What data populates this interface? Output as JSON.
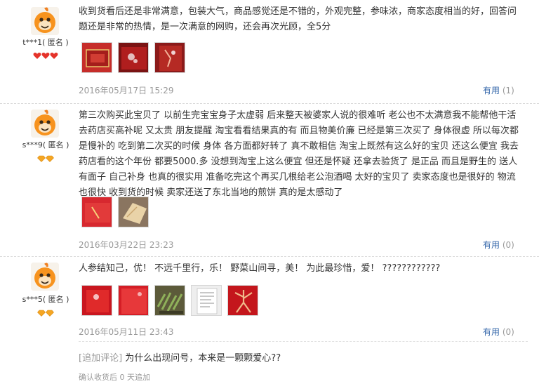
{
  "reviews": [
    {
      "user": "t***1",
      "anon": "( 匿名 )",
      "rank_icon": "red-heart",
      "rank_count": 3,
      "text": "收到货看后还是非常满意，包装大气，商品感觉还是不错的，外观完整，参味浓，商家态度相当的好，回答问题还是非常的热情，是一次满意的网购，还会再次光顾，全5分",
      "date": "2016年05月17日 15:29",
      "useful_label": "有用",
      "useful_count": "(1)",
      "photos": [
        "red",
        "red-dark",
        "red-glare"
      ]
    },
    {
      "user": "s***9",
      "anon": "( 匿名 )",
      "rank_icon": "gold-diamond",
      "rank_count": 2,
      "text": "第三次购买此宝贝了 以前生完宝宝身子太虚弱 后来整天被婆家人说的很难听 老公也不太满意我不能帮他干活 去药店买高补呢 又太贵 朋友提醒 淘宝看看结果真的有 而且物美价廉 已经是第三次买了 身体很虚 所以每次都是慢补的 吃到第二次买的时候 身体 各方面都好转了 真不敢相信 淘宝上既然有这么好的宝贝 还这么便宜 我去药店看的这个年份 都要5000.多 没想到淘宝上这么便宜 但还是怀疑 还拿去验货了 是正品 而且是野生的 送人有面子 自己补身 也真的很实用 准备吃完这个再买几根给老公泡酒喝 太好的宝贝了 卖家态度也是很好的 物流也很快 收到货的时候 卖家还送了东北当地的煎饼 真的是太感动了",
      "date": "2016年03月22日 23:23",
      "useful_label": "有用",
      "useful_count": "(0)",
      "photos": [
        "red-box",
        "pancake"
      ]
    },
    {
      "user": "s***5",
      "anon": "( 匿名 )",
      "rank_icon": "gold-diamond",
      "rank_count": 2,
      "text": "人参结知己，优！ 不远千里行，乐！ 野菜山间寻，美！ 为此最珍惜，爱！ ????????????",
      "date": "2016年05月11日 23:43",
      "useful_label": "有用",
      "useful_count": "(0)",
      "photos": [
        "red-box",
        "red-box2",
        "herbs",
        "document",
        "ginseng"
      ],
      "append_tag": "[追加评论]",
      "append_text": "为什么出现问号，本来是一颗颗爱心??",
      "append_meta": "确认收货后 0 天追加"
    }
  ],
  "colors": {
    "link_blue": "#3366aa",
    "meta_gray": "#999999",
    "heart_red": "#e5332a",
    "diamond_gold": "#f5a623"
  }
}
